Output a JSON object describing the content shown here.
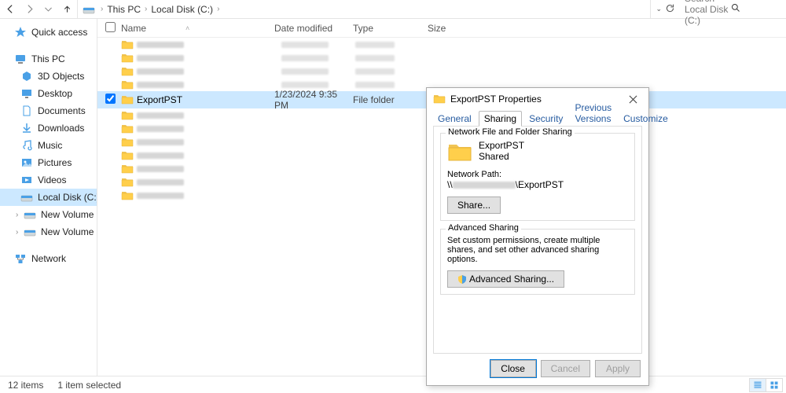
{
  "breadcrumb": {
    "parts": [
      "This PC",
      "Local Disk (C:)"
    ]
  },
  "search": {
    "placeholder": "Search Local Disk (C:)"
  },
  "sidebar": {
    "quick": {
      "label": "Quick access"
    },
    "thispc": {
      "label": "This PC",
      "children": [
        {
          "label": "3D Objects",
          "icon": "box"
        },
        {
          "label": "Desktop",
          "icon": "desktop"
        },
        {
          "label": "Documents",
          "icon": "doc"
        },
        {
          "label": "Downloads",
          "icon": "down"
        },
        {
          "label": "Music",
          "icon": "music"
        },
        {
          "label": "Pictures",
          "icon": "pic"
        },
        {
          "label": "Videos",
          "icon": "vid"
        },
        {
          "label": "Local Disk (C:)",
          "icon": "drive",
          "selected": true
        },
        {
          "label": "New Volume (D:)",
          "icon": "drive",
          "sub": true
        },
        {
          "label": "New Volume (F:)",
          "icon": "drive",
          "sub": true
        }
      ]
    },
    "network": {
      "label": "Network"
    }
  },
  "columns": {
    "name": "Name",
    "date": "Date modified",
    "type": "Type",
    "size": "Size"
  },
  "row": {
    "name": "ExportPST",
    "date": "1/23/2024 9:35 PM",
    "type": "File folder"
  },
  "status": {
    "items": "12 items",
    "selected": "1 item selected"
  },
  "dialog": {
    "title": "ExportPST Properties",
    "tabs": {
      "general": "General",
      "sharing": "Sharing",
      "security": "Security",
      "prev": "Previous Versions",
      "custom": "Customize"
    },
    "nfs": {
      "title": "Network File and Folder Sharing",
      "name": "ExportPST",
      "shared": "Shared",
      "np_label": "Network Path:",
      "np_prefix": "\\\\",
      "np_suffix": "\\ExportPST",
      "share_btn": "Share..."
    },
    "adv": {
      "title": "Advanced Sharing",
      "desc": "Set custom permissions, create multiple shares, and set other advanced sharing options.",
      "btn": "Advanced Sharing..."
    },
    "buttons": {
      "close": "Close",
      "cancel": "Cancel",
      "apply": "Apply"
    }
  }
}
